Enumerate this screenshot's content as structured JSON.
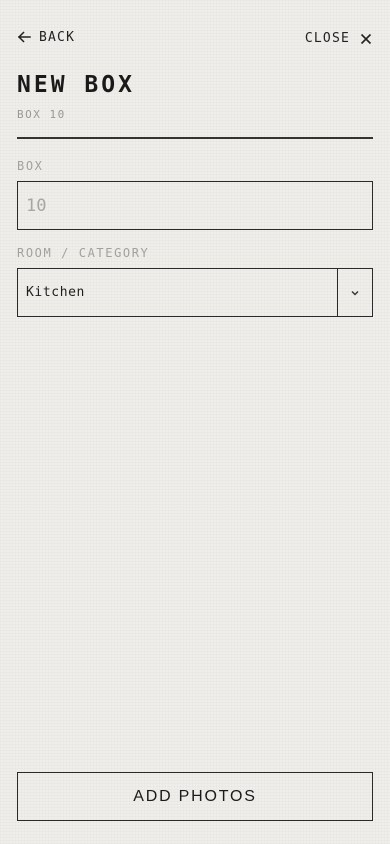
{
  "nav": {
    "back_label": "BACK",
    "close_label": "CLOSE"
  },
  "header": {
    "title": "NEW BOX",
    "subtitle": "BOX 10"
  },
  "form": {
    "box_label": "BOX",
    "box_placeholder": "10",
    "box_value": "",
    "room_label": "ROOM / CATEGORY",
    "room_selected": "Kitchen"
  },
  "actions": {
    "add_photos_label": "ADD PHOTOS"
  },
  "icons": {
    "back": "arrow-left-icon",
    "close": "close-icon",
    "dropdown": "chevron-down-icon"
  }
}
